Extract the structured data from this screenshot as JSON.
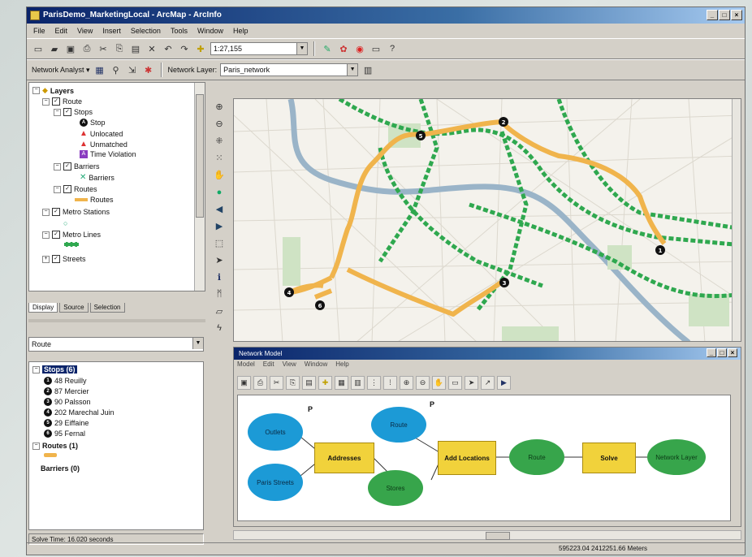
{
  "window": {
    "title": "ParisDemo_MarketingLocal - ArcMap - ArcInfo"
  },
  "menu": [
    "File",
    "Edit",
    "View",
    "Insert",
    "Selection",
    "Tools",
    "Window",
    "Help"
  ],
  "toolbar1": {
    "scale": "1:27,155"
  },
  "toolbar2": {
    "network_analyst_label": "Network Analyst ▾",
    "network_layer_label": "Network Layer:",
    "network_layer_value": "Paris_network"
  },
  "toc": {
    "root": "Layers",
    "route_group": "Route",
    "stops_label": "Stops",
    "stop_items": [
      "Stop",
      "Unlocated",
      "Unmatched",
      "Time Violation"
    ],
    "barriers_label": "Barriers",
    "barriers_item": "Barriers",
    "routes_label": "Routes",
    "routes_item": "Routes",
    "metro_stations": "Metro Stations",
    "metro_lines": "Metro Lines",
    "streets": "Streets"
  },
  "tabs": [
    "Display",
    "Source",
    "Selection"
  ],
  "route_select": "Route",
  "na_window": {
    "stops_header": "Stops (6)",
    "stops": [
      {
        "n": "1",
        "label": "48 Reuilly"
      },
      {
        "n": "2",
        "label": "87 Mercier"
      },
      {
        "n": "3",
        "label": "90 Palsson"
      },
      {
        "n": "4",
        "label": "202 Marechal Juin"
      },
      {
        "n": "5",
        "label": "29 Eiffaine"
      },
      {
        "n": "6",
        "label": "95 Fernal"
      }
    ],
    "routes_header": "Routes (1)",
    "barriers_header": "Barriers (0)"
  },
  "solve_time": "Solve Time: 16.020 seconds",
  "model": {
    "title": "Network Model",
    "menu": [
      "Model",
      "Edit",
      "View",
      "Window",
      "Help"
    ],
    "nodes": {
      "outlets": "Outlets",
      "paris_streets": "Paris Streets",
      "addresses": "Addresses",
      "stores": "Stores",
      "route_in": "Route",
      "add_locations": "Add Locations",
      "route_out": "Route",
      "solve": "Solve",
      "network_layer": "Network Layer"
    },
    "p_label": "P"
  },
  "status": {
    "coords": "595223.04 2412251.66 Meters"
  },
  "map_labels": [
    "1",
    "2",
    "3",
    "4",
    "5",
    "6"
  ],
  "colors": {
    "route": "#f0b44c",
    "metro": "#2fa84f",
    "water": "#9ab4c8",
    "park": "#cfe3c4"
  }
}
